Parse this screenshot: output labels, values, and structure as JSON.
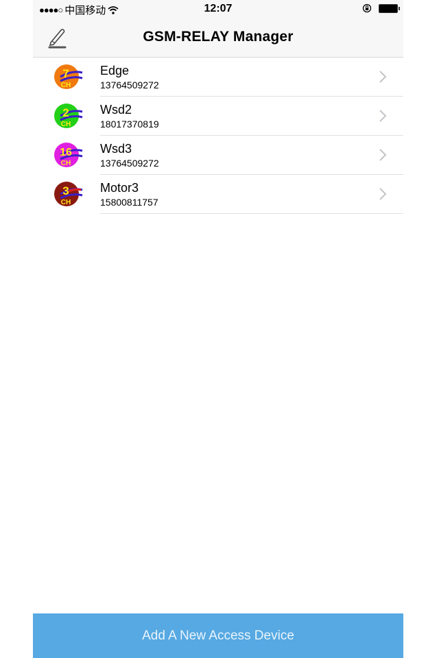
{
  "status_bar": {
    "signal": "●●●●○",
    "carrier": "中国移动",
    "wifi_icon": "wifi-icon",
    "time": "12:07",
    "rotation_lock_icon": "rotation-lock-icon",
    "battery_icon": "battery-icon"
  },
  "navbar": {
    "title": "GSM-RELAY Manager",
    "edit_icon": "pencil-icon"
  },
  "devices": [
    {
      "name": "Edge",
      "phone": "13764509272",
      "channels": "7",
      "ch_label": "CH",
      "color": "#f07a10"
    },
    {
      "name": "Wsd2",
      "phone": "18017370819",
      "channels": "2",
      "ch_label": "CH",
      "color": "#22d018"
    },
    {
      "name": "Wsd3",
      "phone": "13764509272",
      "channels": "16",
      "ch_label": "CH",
      "color": "#e020e0"
    },
    {
      "name": "Motor3",
      "phone": "15800811757",
      "channels": "3",
      "ch_label": "CH",
      "color": "#8a1a10"
    }
  ],
  "add_button": {
    "label": "Add A New Access Device",
    "color": "#56a9e2"
  }
}
